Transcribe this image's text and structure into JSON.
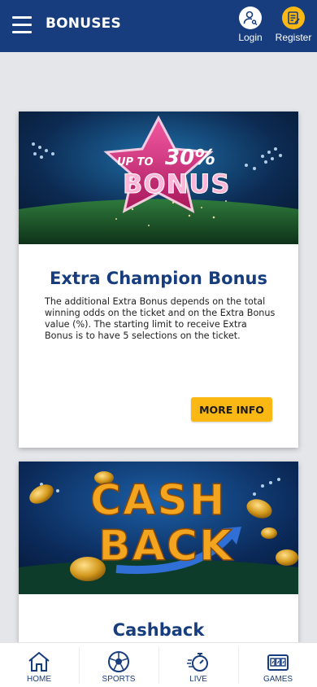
{
  "header": {
    "title": "BONUSES",
    "login_label": "Login",
    "register_label": "Register",
    "bg_color": "#173d7e",
    "accent_color": "#fbb812"
  },
  "promos": [
    {
      "banner": {
        "prefix": "UP TO",
        "percent": "30%",
        "word": "BONUS"
      },
      "title": "Extra Champion Bonus",
      "description": "The additional Extra Bonus depends on the total winning odds on the ticket and on the Extra Bonus value (%). The starting limit to receive Extra Bonus is to have 5 selections on the ticket.",
      "button_label": "MORE INFO"
    },
    {
      "banner": {
        "line1": "CASH",
        "line2": "BACK"
      },
      "title": "Cashback"
    }
  ],
  "bottom_nav": [
    {
      "label": "HOME",
      "icon": "home-icon"
    },
    {
      "label": "SPORTS",
      "icon": "soccer-ball-icon"
    },
    {
      "label": "LIVE",
      "icon": "stopwatch-icon"
    },
    {
      "label": "GAMES",
      "icon": "slot-machine-icon"
    }
  ]
}
